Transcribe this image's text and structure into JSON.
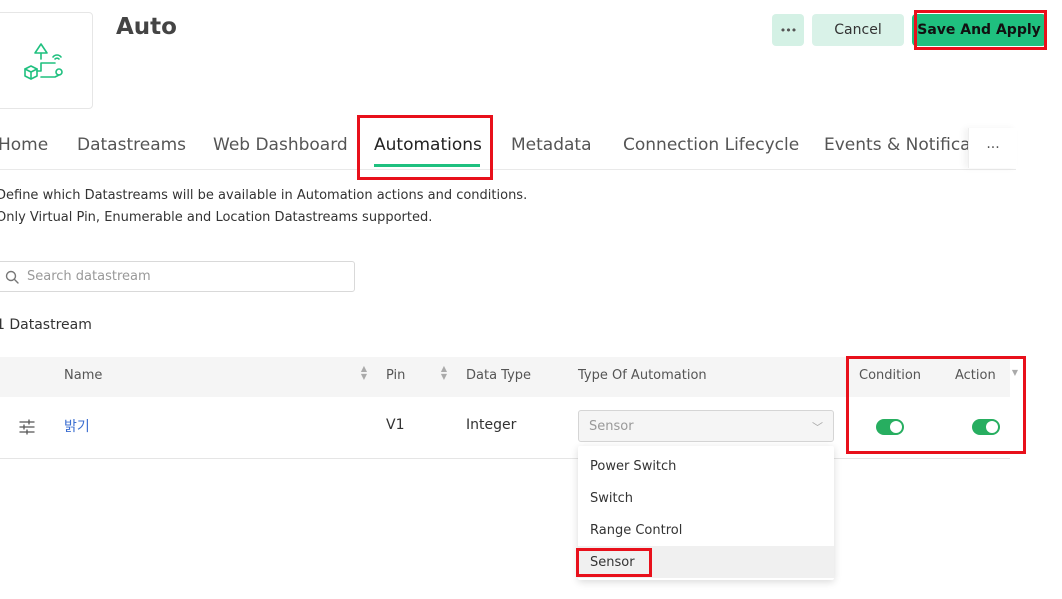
{
  "header": {
    "title": "Auto",
    "more_label": "•••",
    "cancel_label": "Cancel",
    "save_label": "Save And Apply"
  },
  "tabs": [
    {
      "label": "Home"
    },
    {
      "label": "Datastreams"
    },
    {
      "label": "Web Dashboard"
    },
    {
      "label": "Automations"
    },
    {
      "label": "Metadata"
    },
    {
      "label": "Connection Lifecycle"
    },
    {
      "label": "Events & Notificat"
    }
  ],
  "tabs_more": "···",
  "active_tab": "Automations",
  "description": {
    "line1": "Define which Datastreams will be available in Automation actions and conditions.",
    "line2": "Only Virtual Pin, Enumerable and Location Datastreams supported."
  },
  "search": {
    "placeholder": "Search datastream"
  },
  "count_label": "1 Datastream",
  "table": {
    "headers": {
      "name": "Name",
      "pin": "Pin",
      "data_type": "Data Type",
      "type_of_automation": "Type Of Automation",
      "condition": "Condition",
      "action": "Action"
    },
    "rows": [
      {
        "name": "밝기",
        "pin": "V1",
        "data_type": "Integer",
        "type_of_automation": "Sensor",
        "condition": true,
        "action": true
      }
    ]
  },
  "dropdown": {
    "options": [
      "Power Switch",
      "Switch",
      "Range Control",
      "Sensor"
    ],
    "highlighted": "Sensor"
  },
  "colors": {
    "accent": "#1fc07f",
    "toggle_on": "#27ae60",
    "highlight_box": "#e8101b",
    "link": "#3d6fd1"
  },
  "icons": {
    "product": "product-automation-icon",
    "search": "search-icon",
    "row": "sliders-icon",
    "select": "chevron-down-icon"
  }
}
